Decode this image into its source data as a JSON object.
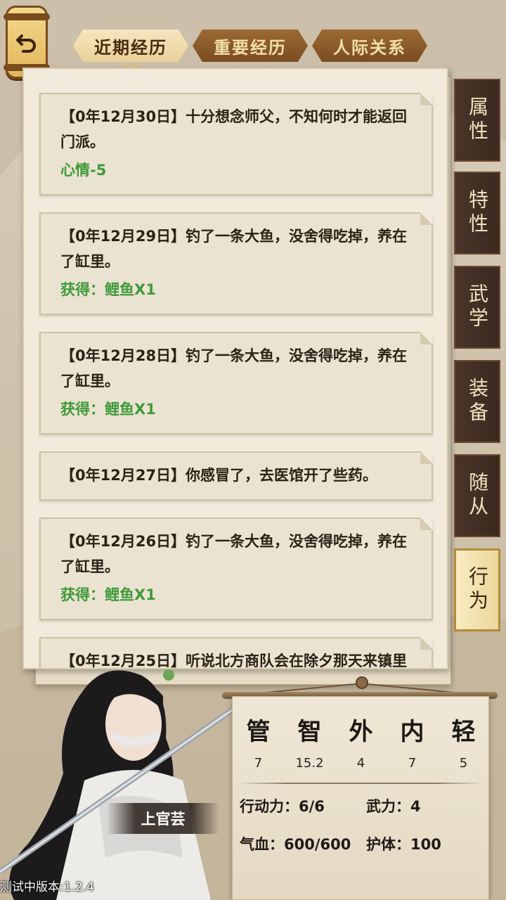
{
  "tabs": [
    {
      "label": "近期经历",
      "active": true
    },
    {
      "label": "重要经历",
      "active": false
    },
    {
      "label": "人际关系",
      "active": false
    }
  ],
  "entries": [
    {
      "text": "【0年12月30日】十分想念师父，不知何时才能返回门派。",
      "effect": "心情-5"
    },
    {
      "text": "【0年12月29日】钓了一条大鱼，没舍得吃掉，养在了缸里。",
      "effect": "获得：鲤鱼X1"
    },
    {
      "text": "【0年12月28日】钓了一条大鱼，没舍得吃掉，养在了缸里。",
      "effect": "获得：鲤鱼X1"
    },
    {
      "text": "【0年12月27日】你感冒了，去医馆开了些药。",
      "effect": ""
    },
    {
      "text": "【0年12月26日】钓了一条大鱼，没舍得吃掉，养在了缸里。",
      "effect": "获得：鲤鱼X1"
    },
    {
      "text": "【0年12月25日】听说北方商队会在除夕那天来镇里",
      "effect": ""
    }
  ],
  "side_tabs": [
    {
      "label": "属性",
      "active": false
    },
    {
      "label": "特性",
      "active": false
    },
    {
      "label": "武学",
      "active": false
    },
    {
      "label": "装备",
      "active": false
    },
    {
      "label": "随从",
      "active": false
    },
    {
      "label": "行为",
      "active": true
    }
  ],
  "character": {
    "name": "上官芸"
  },
  "attributes": [
    {
      "name": "管",
      "value": "7"
    },
    {
      "name": "智",
      "value": "15.2"
    },
    {
      "name": "外",
      "value": "4"
    },
    {
      "name": "内",
      "value": "7"
    },
    {
      "name": "轻",
      "value": "5"
    }
  ],
  "stats": {
    "action": "行动力：6/6",
    "force": "武力：4",
    "hp": "气血：600/600",
    "guard": "护体：100"
  },
  "version": "测试中版本:1.2.4",
  "colors": {
    "accent_green": "#3f9a3a",
    "tab_brown": "#8a5a2a",
    "paper": "#f2ebdc"
  },
  "icons": {
    "back": "back-arrow-icon"
  }
}
